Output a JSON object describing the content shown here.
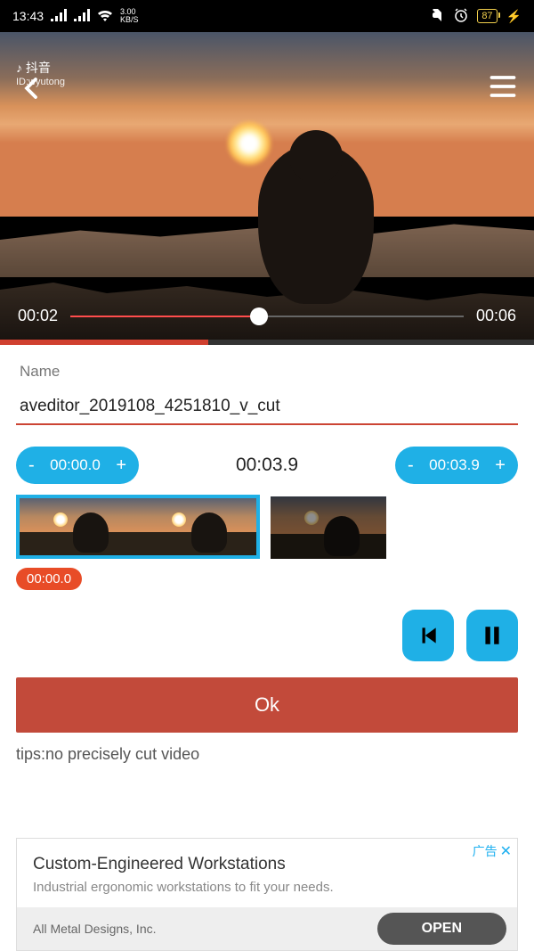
{
  "status": {
    "time": "13:43",
    "net_speed": "3.00",
    "net_unit": "KB/S",
    "battery": "87"
  },
  "video": {
    "watermark_app": "抖音",
    "watermark_id": "ID:wyutong",
    "current_time": "00:02",
    "total_time": "00:06"
  },
  "form": {
    "name_label": "Name",
    "name_value": "aveditor_2019108_4251810_v_cut"
  },
  "cut": {
    "start_time": "00:00.0",
    "center_time": "00:03.9",
    "end_time": "00:03.9",
    "badge_time": "00:00.0",
    "minus": "-",
    "plus": "+"
  },
  "buttons": {
    "ok": "Ok"
  },
  "tips": "tips:no precisely cut video",
  "ad": {
    "label": "广告",
    "close": "✕",
    "title": "Custom-Engineered Workstations",
    "desc": "Industrial ergonomic workstations to fit your needs.",
    "company": "All Metal Designs, Inc.",
    "open": "OPEN"
  }
}
